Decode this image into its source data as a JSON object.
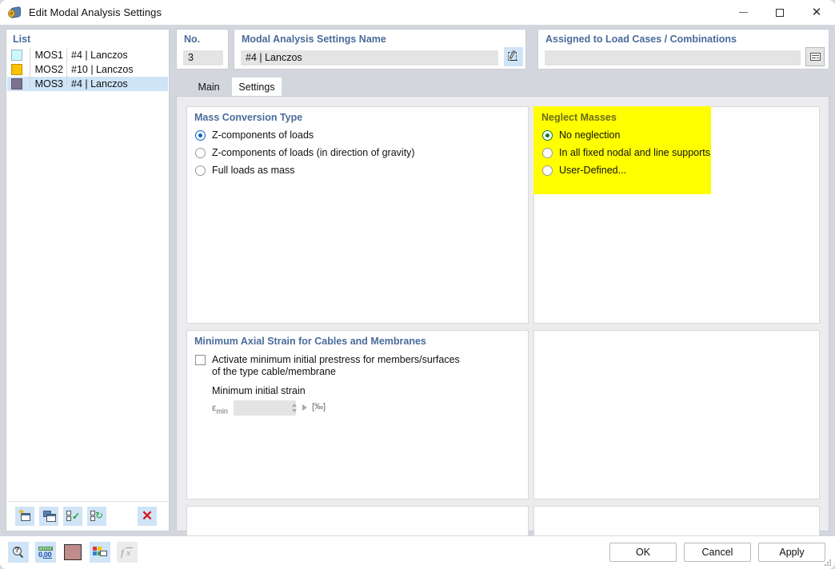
{
  "window": {
    "title": "Edit Modal Analysis Settings",
    "icon": "modal-analysis-icon",
    "minimize_label": "—",
    "maximize_label": "□",
    "close_label": "✕"
  },
  "list_panel": {
    "title": "List",
    "rows": [
      {
        "color": "#CCF9FB",
        "name": "MOS1",
        "description": "#4 | Lanczos",
        "selected": false
      },
      {
        "color": "#FAC200",
        "name": "MOS2",
        "description": "#10 | Lanczos",
        "selected": false
      },
      {
        "color": "#7E7190",
        "name": "MOS3",
        "description": "#4 | Lanczos",
        "selected": true
      }
    ],
    "toolbar": [
      {
        "name": "new-item-button",
        "icon": "new-window-star-icon"
      },
      {
        "name": "copy-item-button",
        "icon": "copy-window-icon"
      },
      {
        "name": "select-all-button",
        "icon": "checkboxes-check-icon"
      },
      {
        "name": "invert-selection-button",
        "icon": "checkboxes-refresh-icon"
      },
      {
        "name": "delete-item-button",
        "icon": "red-x-icon"
      }
    ]
  },
  "no_card": {
    "label": "No.",
    "value": "3"
  },
  "name_card": {
    "label": "Modal Analysis Settings Name",
    "value": "#4 | Lanczos",
    "edit_button_icon": "pencil-edit-icon"
  },
  "assigned_card": {
    "label": "Assigned to Load Cases / Combinations",
    "value": "",
    "button_icon": "table-select-icon"
  },
  "tabs": [
    {
      "label": "Main",
      "active": false,
      "name": "tab-main"
    },
    {
      "label": "Settings",
      "active": true,
      "name": "tab-settings"
    }
  ],
  "mass_conversion": {
    "title": "Mass Conversion Type",
    "options": [
      {
        "label": "Z-components of loads",
        "checked": true
      },
      {
        "label": "Z-components of loads (in direction of gravity)",
        "checked": false
      },
      {
        "label": "Full loads as mass",
        "checked": false
      }
    ]
  },
  "neglect_masses": {
    "title": "Neglect Masses",
    "highlight_color": "#FFFF00",
    "accent_color": "#0A7A33",
    "options": [
      {
        "label": "No neglection",
        "checked": true
      },
      {
        "label": "In all fixed nodal and line supports",
        "checked": false
      },
      {
        "label": "User-Defined...",
        "checked": false
      }
    ]
  },
  "min_axial_strain": {
    "title": "Minimum Axial Strain for Cables and Membranes",
    "checkbox": {
      "checked": false,
      "line1": "Activate minimum initial prestress for members/surfaces",
      "line2": "of the type cable/membrane"
    },
    "field_label": "Minimum initial strain",
    "symbol": "ε",
    "symbol_sub": "min",
    "value": "",
    "unit": "[‰]"
  },
  "footer": {
    "tools": [
      {
        "name": "find-button",
        "icon": "magnifier-question-icon"
      },
      {
        "name": "decimal-places-button",
        "icon": "number-format-icon"
      },
      {
        "name": "color-button",
        "icon": "color-swatch-icon",
        "color": "#C08B8B"
      },
      {
        "name": "legend-button",
        "icon": "legend-icon"
      },
      {
        "name": "formula-button",
        "icon": "function-icon",
        "disabled": true
      }
    ],
    "buttons": [
      {
        "label": "OK",
        "name": "ok-button"
      },
      {
        "label": "Cancel",
        "name": "cancel-button"
      },
      {
        "label": "Apply",
        "name": "apply-button"
      }
    ]
  }
}
